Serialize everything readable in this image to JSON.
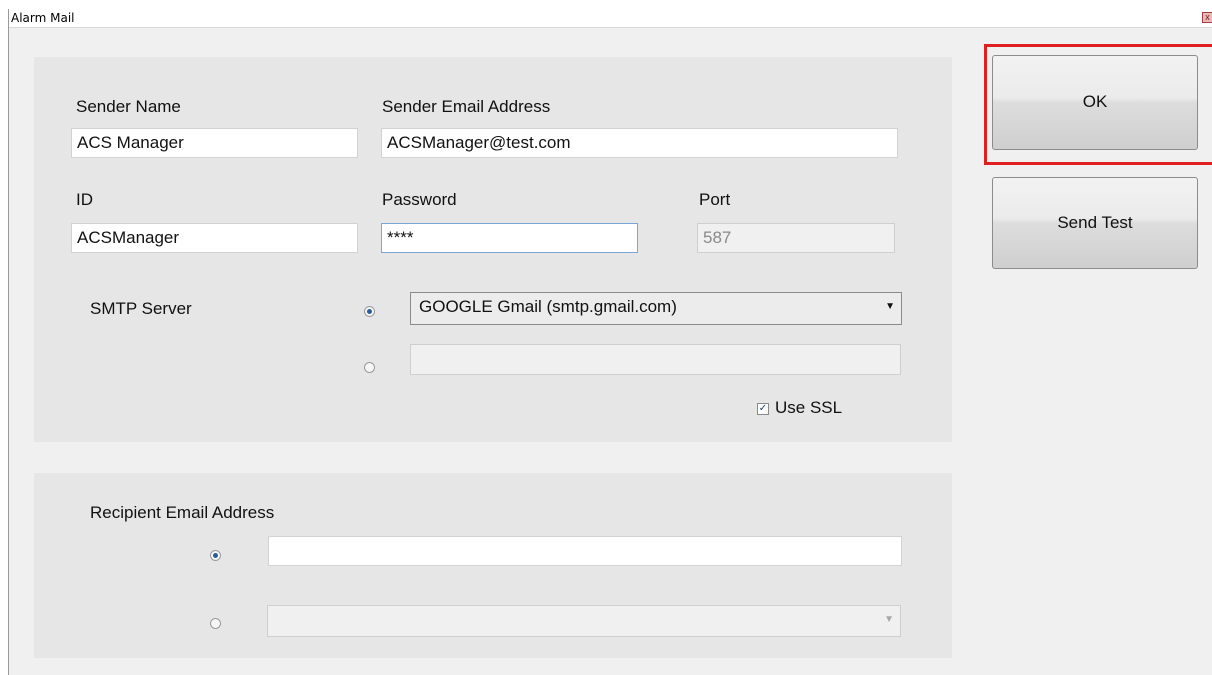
{
  "window": {
    "title": "Alarm Mail",
    "close_icon": "close-icon",
    "close_glyph": "x"
  },
  "sender": {
    "name_label": "Sender Name",
    "name_value": "ACS Manager",
    "email_label": "Sender Email Address",
    "email_value": "ACSManager@test.com",
    "id_label": "ID",
    "id_value": "ACSManager",
    "password_label": "Password",
    "password_value": "****",
    "port_label": "Port",
    "port_value": "587"
  },
  "smtp": {
    "label": "SMTP Server",
    "preset_selected": true,
    "preset_value": "GOOGLE Gmail (smtp.gmail.com)",
    "custom_value": "",
    "use_ssl_label": "Use SSL",
    "use_ssl_checked": true
  },
  "recipient": {
    "label": "Recipient Email Address",
    "manual_selected": true,
    "manual_value": "",
    "list_value": ""
  },
  "buttons": {
    "ok": "OK",
    "send_test": "Send Test"
  },
  "colors": {
    "highlight": "#e02020",
    "radio_dot": "#2a5d9a"
  }
}
